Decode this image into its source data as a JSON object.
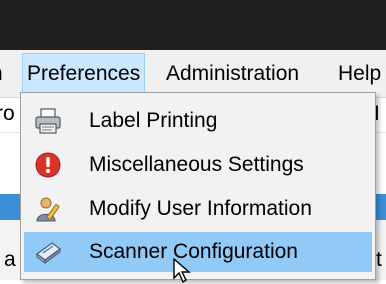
{
  "menubar": {
    "partial_left_label": "n",
    "items": [
      {
        "label": "Preferences"
      },
      {
        "label": "Administration"
      },
      {
        "label": "Help"
      }
    ]
  },
  "background": {
    "text_row1_left": "ro",
    "text_row1_right": "I",
    "text_bottom_left": "a",
    "text_bottom_right": "t"
  },
  "dropdown": {
    "items": [
      {
        "label": "Label Printing",
        "icon": "printer-icon"
      },
      {
        "label": "Miscellaneous Settings",
        "icon": "alert-icon"
      },
      {
        "label": "Modify User Information",
        "icon": "user-edit-icon"
      },
      {
        "label": "Scanner Configuration",
        "icon": "scanner-icon",
        "selected": true
      }
    ]
  },
  "colors": {
    "menu_highlight": "#cce8ff",
    "selected_item": "#91c9f7",
    "title_bar": "#1f1f1f"
  }
}
